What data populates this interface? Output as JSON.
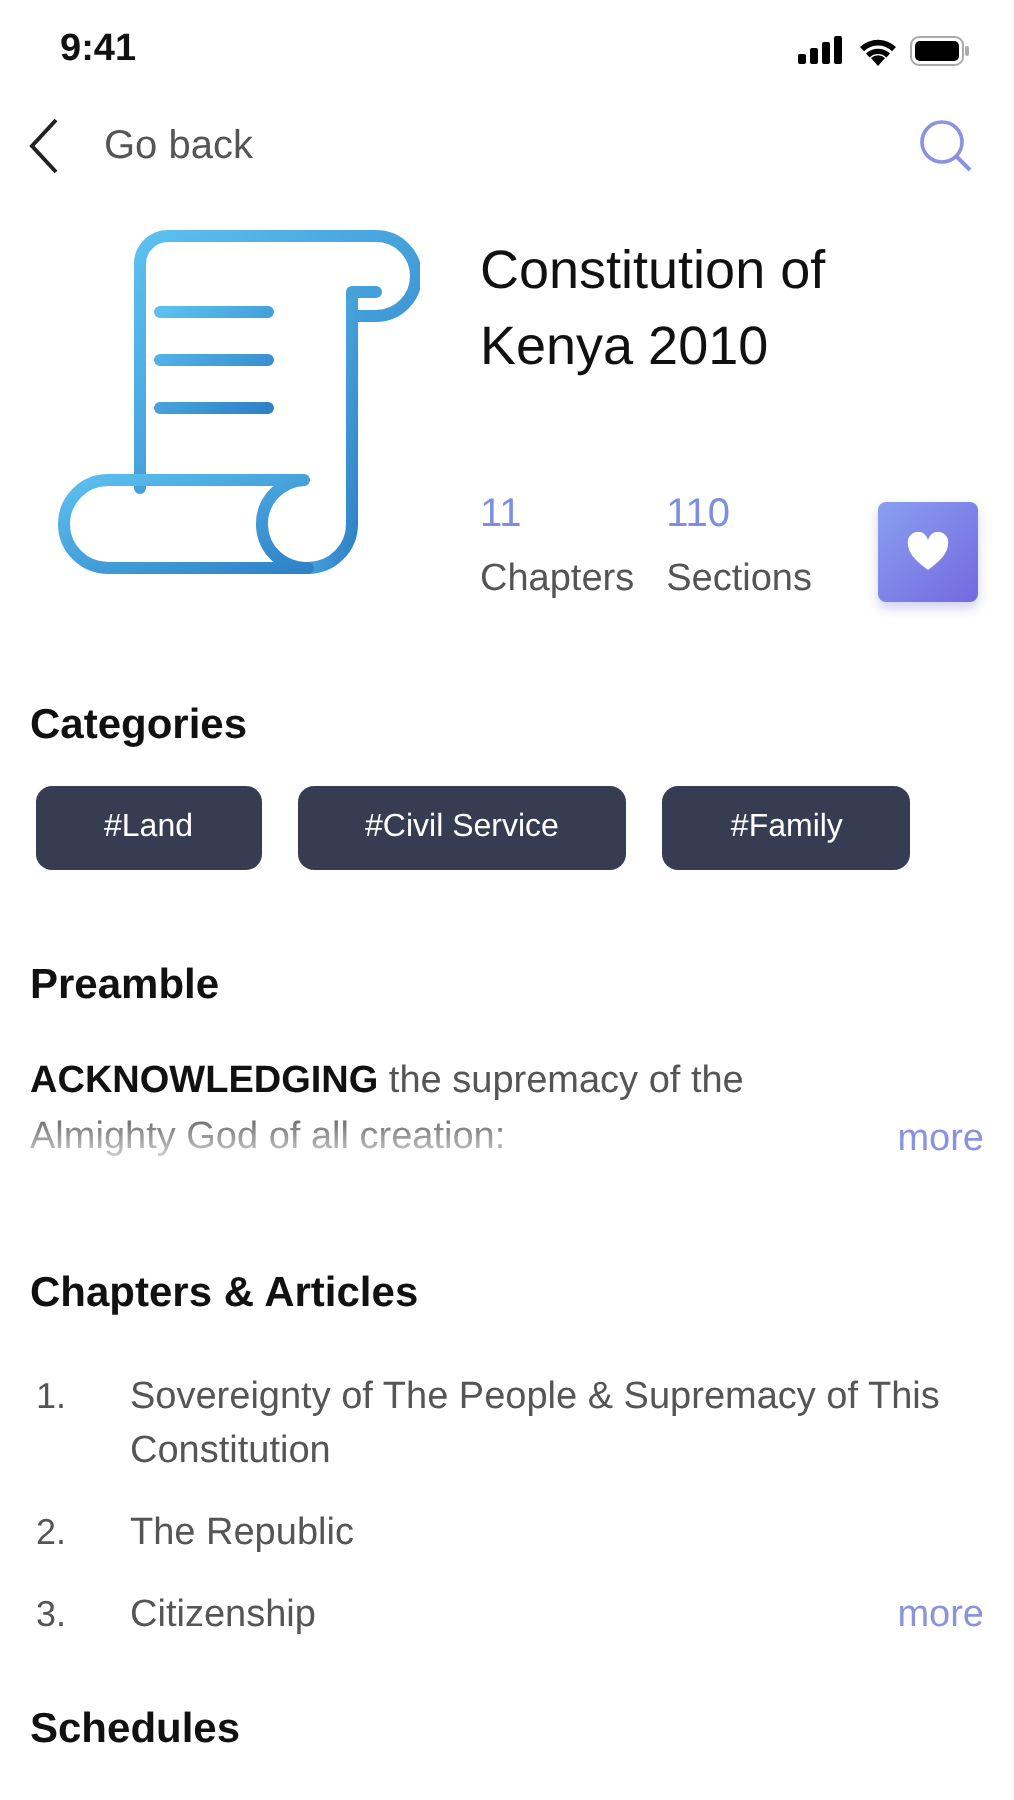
{
  "status_bar": {
    "time": "9:41"
  },
  "nav": {
    "back_label": "Go back"
  },
  "document": {
    "title": "Constitution of Kenya 2010",
    "stats": [
      {
        "value": "11",
        "label": "Chapters"
      },
      {
        "value": "110",
        "label": "Sections"
      }
    ],
    "favorite": true
  },
  "categories": {
    "heading": "Categories",
    "tags": [
      "#Land",
      "#Civil Service",
      "#Family"
    ]
  },
  "preamble": {
    "heading": "Preamble",
    "text": "**ACKNOWLEDGING** the supremacy of the Almighty God of all creation:",
    "more": "more"
  },
  "chapters": {
    "heading": "Chapters & Articles",
    "items": [
      {
        "number": "1.",
        "title": "Sovereignty of The People & Supremacy of This Constitution"
      },
      {
        "number": "2.",
        "title": "The Republic"
      },
      {
        "number": "3.",
        "title": "Citizenship"
      }
    ],
    "more": "more"
  },
  "next_section": {
    "heading": "Schedules"
  }
}
